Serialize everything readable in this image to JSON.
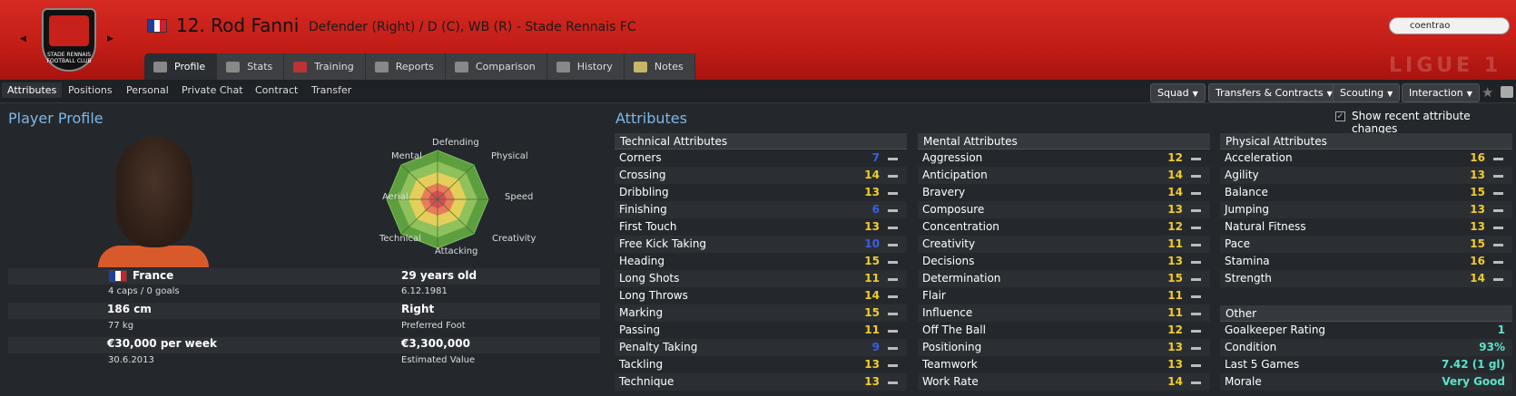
{
  "header": {
    "number_name": "12. Rod Fanni",
    "role": "Defender (Right) / D (C), WB (R) - Stade Rennais FC",
    "crest_text": "STADE RENNAIS FOOTBALL CLUB",
    "search_value": "coentrao",
    "league_mark": "LIGUE 1",
    "flag_colors": [
      "#1f3f9a",
      "#ffffff",
      "#d0202a"
    ]
  },
  "tabs": [
    {
      "label": "Profile",
      "icon": "profile-icon"
    },
    {
      "label": "Stats",
      "icon": "stats-icon"
    },
    {
      "label": "Training",
      "icon": "training-icon"
    },
    {
      "label": "Reports",
      "icon": "reports-icon"
    },
    {
      "label": "Comparison",
      "icon": "comparison-icon"
    },
    {
      "label": "History",
      "icon": "history-icon"
    },
    {
      "label": "Notes",
      "icon": "notes-icon"
    }
  ],
  "subtabs": [
    "Attributes",
    "Positions",
    "Personal",
    "Private Chat",
    "Contract",
    "Transfer"
  ],
  "actions": [
    "Squad",
    "Transfers & Contracts",
    "Scouting",
    "Interaction"
  ],
  "profile": {
    "title": "Player Profile",
    "radar_labels": {
      "defending": "Defending",
      "physical": "Physical",
      "speed": "Speed",
      "creativity": "Creativity",
      "attacking": "Attacking",
      "technical": "Technical",
      "aerial": "Aerial",
      "mental": "Mental"
    },
    "nation": "France",
    "caps": "4 caps / 0 goals",
    "height": "186 cm",
    "weight": "77 kg",
    "wage": "€30,000 per week",
    "contract_end": "30.6.2013",
    "age": "29 years old",
    "dob": "6.12.1981",
    "foot": "Right",
    "foot_label": "Preferred Foot",
    "value": "€3,300,000",
    "value_label": "Estimated Value"
  },
  "attributes": {
    "title": "Attributes",
    "recent_label": "Show recent attribute changes",
    "technical": {
      "header": "Technical Attributes",
      "rows": [
        {
          "name": "Corners",
          "value": "7"
        },
        {
          "name": "Crossing",
          "value": "14"
        },
        {
          "name": "Dribbling",
          "value": "13"
        },
        {
          "name": "Finishing",
          "value": "6"
        },
        {
          "name": "First Touch",
          "value": "13"
        },
        {
          "name": "Free Kick Taking",
          "value": "10"
        },
        {
          "name": "Heading",
          "value": "15"
        },
        {
          "name": "Long Shots",
          "value": "11"
        },
        {
          "name": "Long Throws",
          "value": "14"
        },
        {
          "name": "Marking",
          "value": "15"
        },
        {
          "name": "Passing",
          "value": "11"
        },
        {
          "name": "Penalty Taking",
          "value": "9"
        },
        {
          "name": "Tackling",
          "value": "13"
        },
        {
          "name": "Technique",
          "value": "13"
        }
      ]
    },
    "mental": {
      "header": "Mental Attributes",
      "rows": [
        {
          "name": "Aggression",
          "value": "12"
        },
        {
          "name": "Anticipation",
          "value": "14"
        },
        {
          "name": "Bravery",
          "value": "14"
        },
        {
          "name": "Composure",
          "value": "13"
        },
        {
          "name": "Concentration",
          "value": "12"
        },
        {
          "name": "Creativity",
          "value": "11"
        },
        {
          "name": "Decisions",
          "value": "13"
        },
        {
          "name": "Determination",
          "value": "15"
        },
        {
          "name": "Flair",
          "value": "11"
        },
        {
          "name": "Influence",
          "value": "11"
        },
        {
          "name": "Off The Ball",
          "value": "12"
        },
        {
          "name": "Positioning",
          "value": "13"
        },
        {
          "name": "Teamwork",
          "value": "13"
        },
        {
          "name": "Work Rate",
          "value": "14"
        }
      ]
    },
    "physical": {
      "header": "Physical Attributes",
      "rows": [
        {
          "name": "Acceleration",
          "value": "16"
        },
        {
          "name": "Agility",
          "value": "13"
        },
        {
          "name": "Balance",
          "value": "15"
        },
        {
          "name": "Jumping",
          "value": "13"
        },
        {
          "name": "Natural Fitness",
          "value": "13"
        },
        {
          "name": "Pace",
          "value": "15"
        },
        {
          "name": "Stamina",
          "value": "16"
        },
        {
          "name": "Strength",
          "value": "14"
        }
      ]
    },
    "other": {
      "header": "Other",
      "rows": [
        {
          "name": "Goalkeeper Rating",
          "value": "1"
        },
        {
          "name": "Condition",
          "value": "93%"
        },
        {
          "name": "Last 5 Games",
          "value": "7.42 (1 gl)"
        },
        {
          "name": "Morale",
          "value": "Very Good"
        }
      ]
    }
  }
}
